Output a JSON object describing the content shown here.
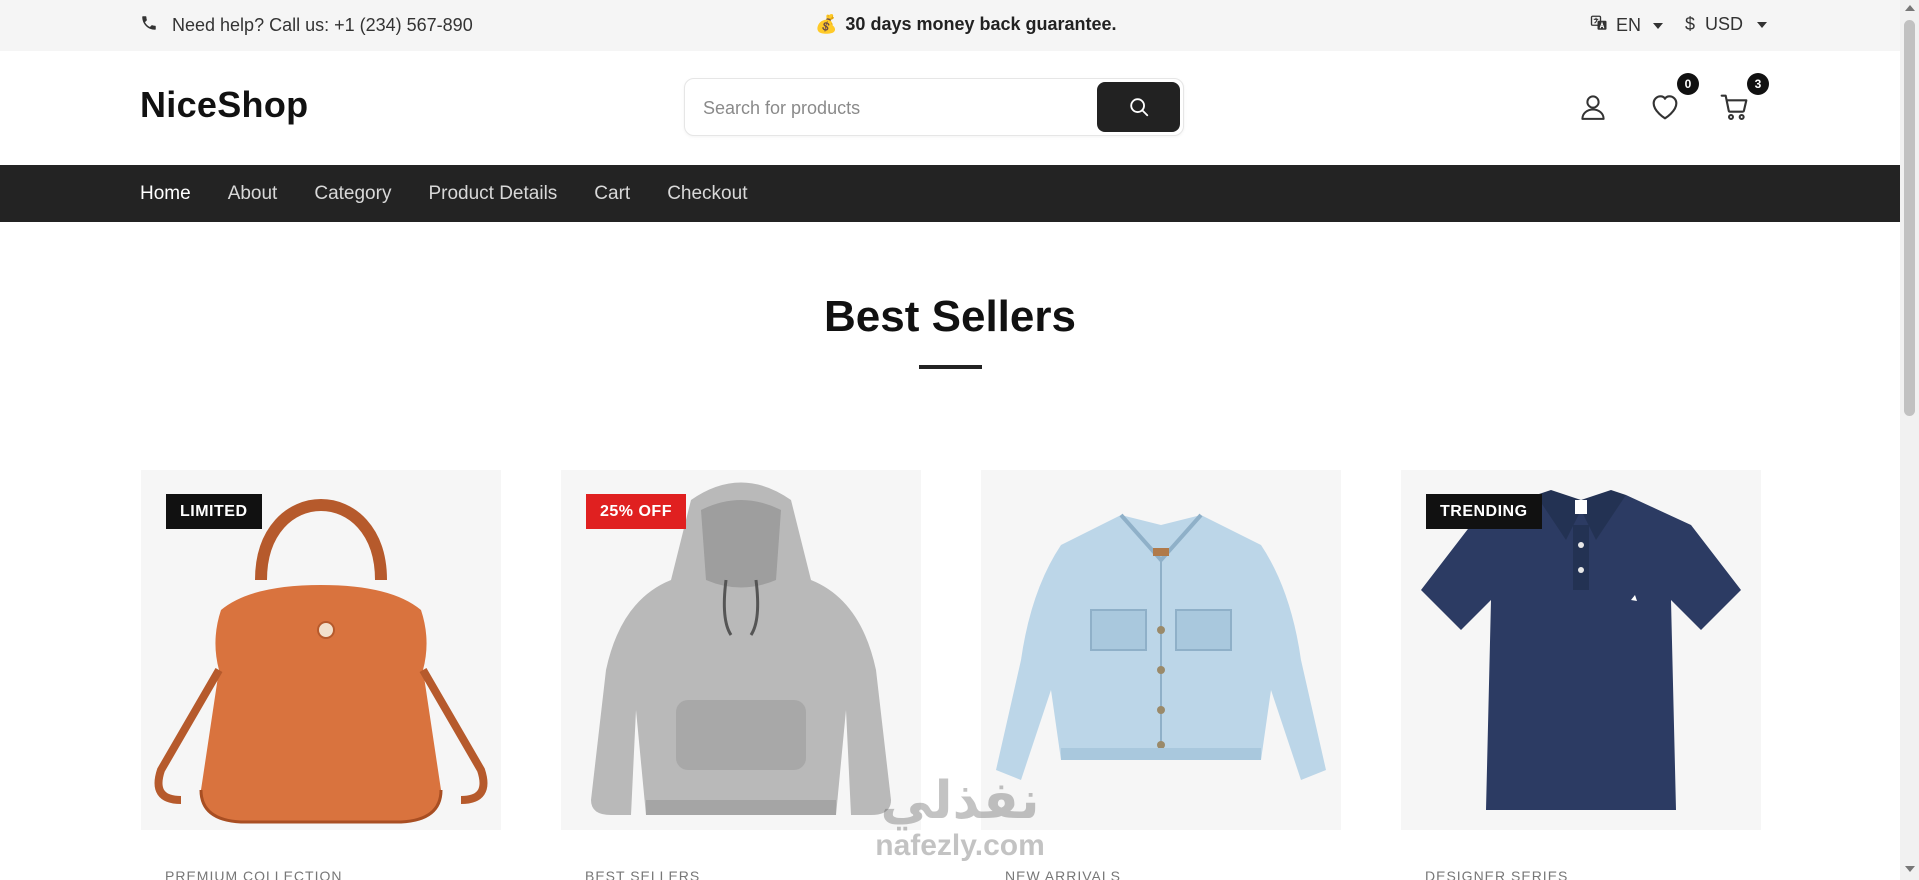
{
  "topbar": {
    "help_text": "Need help? Call us: +1 (234) 567-890",
    "promo_emoji": "💰",
    "promo_text": "30 days money back guarantee.",
    "language": "EN",
    "currency_symbol": "$",
    "currency": "USD"
  },
  "header": {
    "logo": "NiceShop",
    "search_placeholder": "Search for products",
    "wishlist_count": "0",
    "cart_count": "3"
  },
  "nav": {
    "items": [
      {
        "label": "Home",
        "active": true
      },
      {
        "label": "About"
      },
      {
        "label": "Category"
      },
      {
        "label": "Product Details"
      },
      {
        "label": "Cart"
      },
      {
        "label": "Checkout"
      }
    ]
  },
  "section": {
    "title": "Best Sellers"
  },
  "products": [
    {
      "tag": "LIMITED",
      "category": "PREMIUM COLLECTION",
      "image": "orange-leather-tote-bag"
    },
    {
      "tag": "25% OFF",
      "category": "BEST SELLERS",
      "image": "grey-hoodie"
    },
    {
      "tag": "",
      "category": "NEW ARRIVALS",
      "image": "light-denim-jacket"
    },
    {
      "tag": "TRENDING",
      "category": "DESIGNER SERIES",
      "image": "navy-polo-shirt"
    }
  ],
  "watermark": {
    "arabic": "نفذلي",
    "latin": "nafezly.com"
  },
  "colors": {
    "nav_background": "#232323",
    "sale_tag": "#e02020",
    "tag_default": "#111111",
    "topbar_background": "#f5f5f5"
  }
}
